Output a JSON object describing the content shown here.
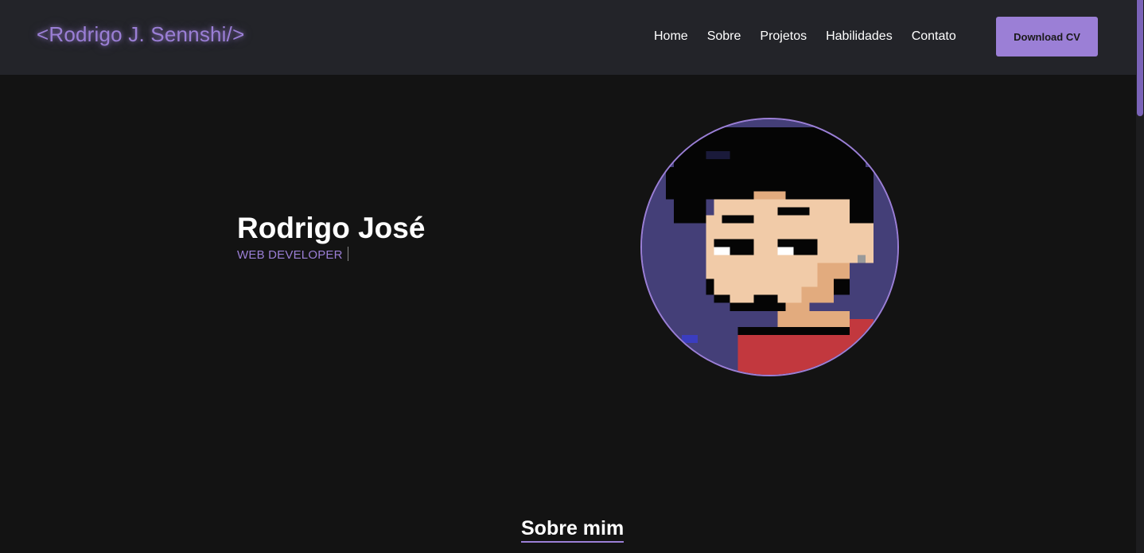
{
  "header": {
    "logo": "<Rodrigo J. Sennshi/>",
    "nav": [
      {
        "label": "Home"
      },
      {
        "label": "Sobre"
      },
      {
        "label": "Projetos"
      },
      {
        "label": "Habilidades"
      },
      {
        "label": "Contato"
      }
    ],
    "cv_button": "Download CV"
  },
  "hero": {
    "name": "Rodrigo José",
    "role": "WEB DEVELOPER",
    "avatar_icon": "pixel-art-avatar"
  },
  "about": {
    "title": "Sobre mim"
  },
  "colors": {
    "accent": "#9b7fd6",
    "header_bg": "#232429",
    "page_bg": "#131313",
    "avatar_bg": "#443f78"
  }
}
